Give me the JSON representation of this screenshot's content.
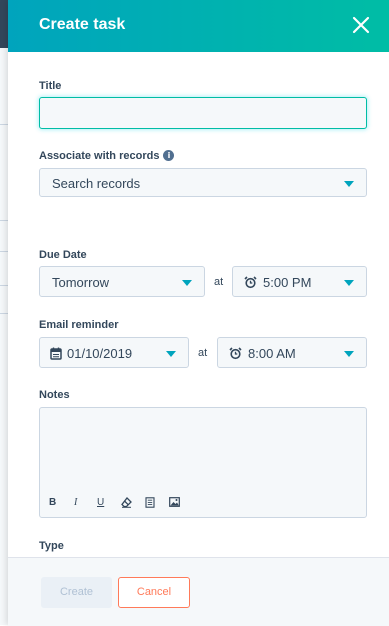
{
  "header": {
    "title": "Create task"
  },
  "form": {
    "title_label": "Title",
    "title_value": "",
    "associate_label": "Associate with records",
    "associate_placeholder": "Search records",
    "due_date_label": "Due Date",
    "due_date_value": "Tomorrow",
    "at_label": "at",
    "due_time_value": "5:00 PM",
    "email_reminder_label": "Email reminder",
    "reminder_date_value": "01/10/2019",
    "reminder_time_value": "8:00 AM",
    "notes_label": "Notes",
    "notes_value": "",
    "notes_toolbar": {
      "bold": "B",
      "italic": "I",
      "underline": "U"
    },
    "type_label": "Type"
  },
  "footer": {
    "create_label": "Create",
    "cancel_label": "Cancel"
  },
  "colors": {
    "header_start": "#00a4bd",
    "header_end": "#00bda5",
    "accent": "#00a4bd",
    "cancel": "#ff7a59"
  }
}
